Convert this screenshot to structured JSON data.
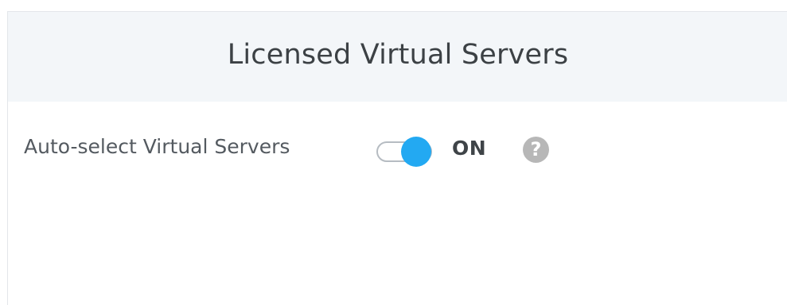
{
  "panel": {
    "title": "Licensed Virtual Servers"
  },
  "setting": {
    "label": "Auto-select Virtual Servers",
    "toggle_state": "ON",
    "toggle_on": true,
    "accent_color": "#23a9f2",
    "help_icon": "question-mark-icon",
    "help_glyph": "?"
  }
}
